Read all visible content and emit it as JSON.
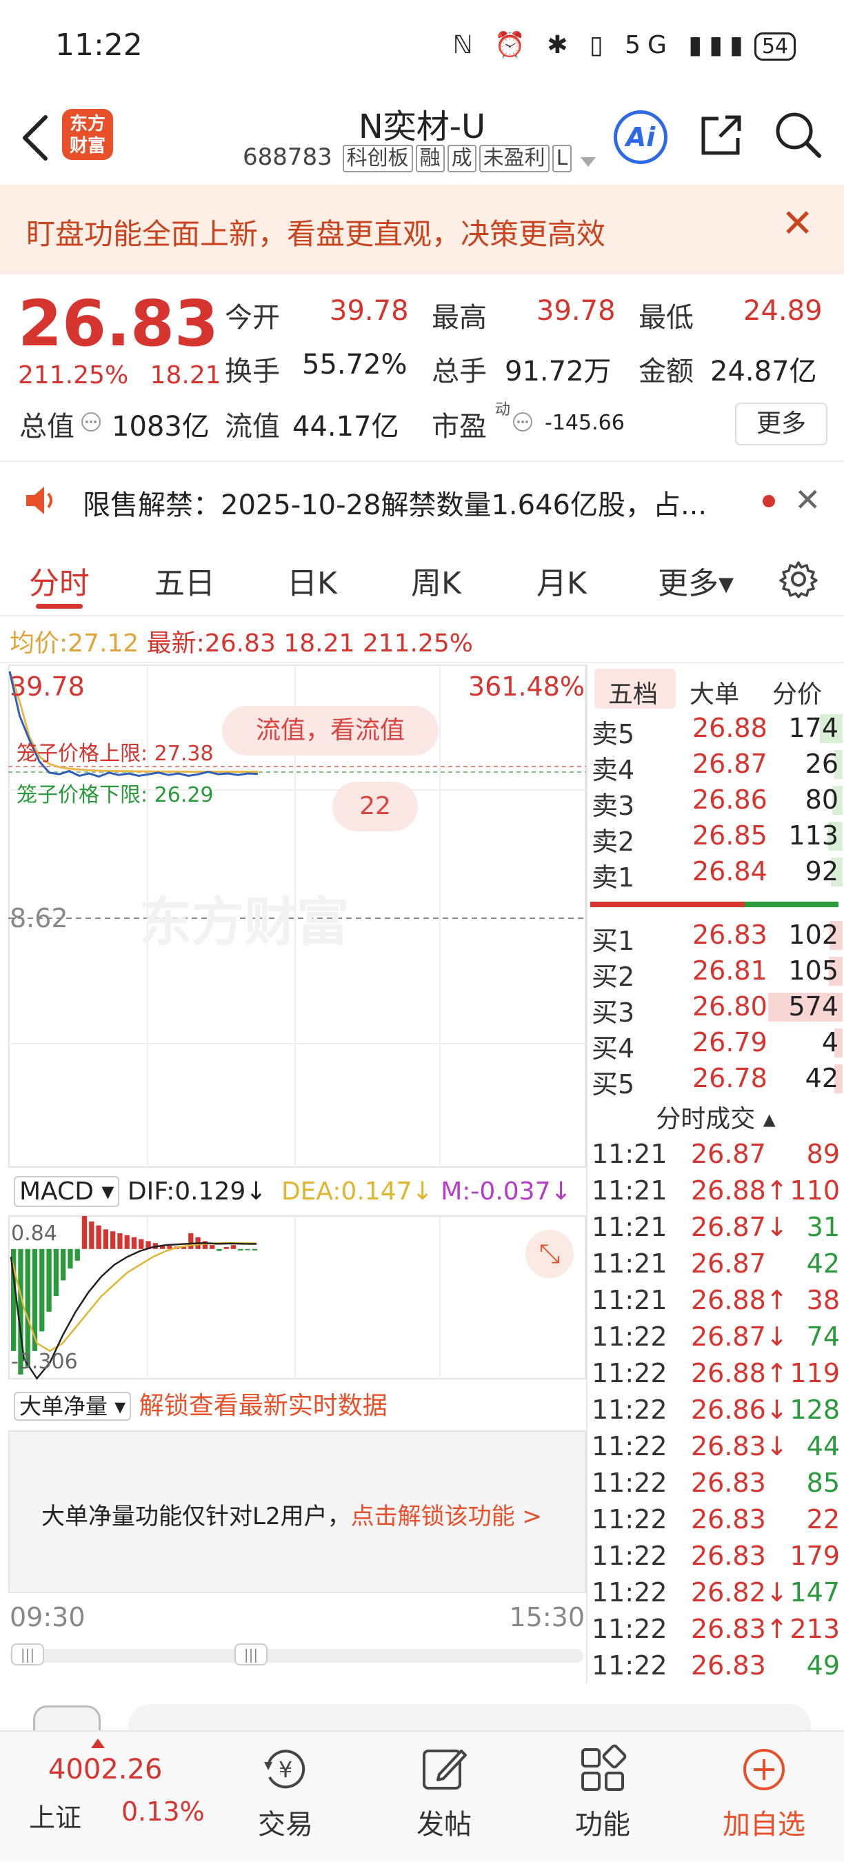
{
  "status_bar": {
    "time": "11:22",
    "icons": "ℕ ⏰ ✱ ▯ 5G ▮▮▮",
    "battery": "54"
  },
  "header": {
    "logo_line1": "东方",
    "logo_line2": "财富",
    "title": "N奕材-U",
    "code": "688783",
    "tags": [
      "科创板",
      "融",
      "成",
      "未盈利",
      "L"
    ],
    "ai_label": "Ai"
  },
  "banner": {
    "text": "盯盘功能全面上新，看盘更直观，决策更高效"
  },
  "quote": {
    "price": "26.83",
    "change_pct": "211.25%",
    "change_amt": "18.21",
    "fields": [
      {
        "label": "今开",
        "value": "39.78",
        "color": "#d6352f"
      },
      {
        "label": "最高",
        "value": "39.78",
        "color": "#d6352f"
      },
      {
        "label": "最低",
        "value": "24.89",
        "color": "#d6352f"
      },
      {
        "label": "换手",
        "value": "55.72%",
        "color": "#222222"
      },
      {
        "label": "总手",
        "value": "91.72万",
        "color": "#222222"
      },
      {
        "label": "金额",
        "value": "24.87亿",
        "color": "#222222"
      },
      {
        "label": "总值",
        "value": "1083亿",
        "color": "#222222"
      },
      {
        "label": "流值",
        "value": "44.17亿",
        "color": "#222222"
      },
      {
        "label": "市盈",
        "value": "-145.66",
        "color": "#222222"
      }
    ],
    "pe_superscript": "动",
    "more_button": "更多"
  },
  "notice": {
    "text": "限售解禁：2025-10-28解禁数量1.646亿股，占..."
  },
  "tabs": [
    "分时",
    "五日",
    "日K",
    "周K",
    "月K",
    "更多▾"
  ],
  "info_line": {
    "avg_label": "均价:",
    "avg_value": "27.12",
    "latest_label": "最新:",
    "latest_value": "26.83",
    "change_amt": "18.21",
    "change_pct": "211.25%"
  },
  "chart": {
    "top_price": "39.78",
    "top_pct": "361.48%",
    "ref_price": "8.62",
    "upper_limit_label": "笼子价格上限: 27.38",
    "lower_limit_label": "笼子价格下限: 26.29",
    "bubble1": "流值，看流值",
    "bubble2": "22",
    "watermark": "东方财富",
    "price_line": [
      39.78,
      34.2,
      31.1,
      28.4,
      27.0,
      26.8,
      27.2,
      26.6,
      26.9,
      26.5,
      27.0,
      26.7,
      26.9,
      26.6,
      26.8,
      27.0,
      26.7,
      26.9,
      26.6,
      26.8,
      27.1,
      26.8,
      26.9,
      26.7,
      26.9,
      26.83
    ],
    "avg_line": [
      39.78,
      36.0,
      31.5,
      29.0,
      28.1,
      27.7,
      27.5,
      27.4,
      27.3,
      27.25,
      27.2,
      27.2,
      27.18,
      27.16,
      27.15,
      27.14,
      27.14,
      27.13,
      27.13,
      27.12,
      27.12,
      27.12,
      27.12,
      27.12,
      27.12,
      27.12
    ],
    "y_range": [
      8.62,
      39.78
    ],
    "time_start": "09:30",
    "time_end": "15:30"
  },
  "macd": {
    "selector": "MACD ▾",
    "dif": "DIF:0.129↓",
    "dea": "DEA:0.147↓",
    "m": "M:-0.037↓",
    "top_value": "0.84",
    "bottom_value": "-3.306",
    "bars": [
      -2.6,
      -3.2,
      -3.0,
      -2.6,
      -2.1,
      -1.6,
      -1.2,
      -0.8,
      -0.5,
      -0.3,
      0.84,
      0.7,
      0.6,
      0.5,
      0.45,
      0.4,
      0.35,
      0.3,
      0.25,
      0.2,
      0.15,
      0.1,
      0.08,
      0.06,
      0.05,
      0.4,
      0.3,
      0.2,
      0.1,
      -0.05,
      0.05,
      0.1,
      -0.04,
      -0.03,
      -0.037
    ],
    "dif_line": [
      -0.2,
      -2.8,
      -3.3,
      -2.9,
      -2.2,
      -1.6,
      -1.1,
      -0.7,
      -0.4,
      -0.2,
      -0.05,
      0.05,
      0.1,
      0.12,
      0.14,
      0.15,
      0.13,
      0.14,
      0.13,
      0.129
    ],
    "dea_line": [
      -0.2,
      -1.5,
      -2.4,
      -2.6,
      -2.4,
      -2.0,
      -1.6,
      -1.2,
      -0.9,
      -0.6,
      -0.4,
      -0.2,
      -0.05,
      0.05,
      0.1,
      0.13,
      0.15,
      0.15,
      0.148,
      0.147
    ]
  },
  "big_order": {
    "selector": "大单净量 ▾",
    "unlock_link": "解锁查看最新实时数据",
    "notice_text": "大单净量功能仅针对L2用户，",
    "notice_link": "点击解锁该功能 >"
  },
  "order_book": {
    "tabs": [
      "五档",
      "大单",
      "分价"
    ],
    "asks": [
      {
        "label": "卖5",
        "price": "26.88",
        "volume": "174"
      },
      {
        "label": "卖4",
        "price": "26.87",
        "volume": "26"
      },
      {
        "label": "卖3",
        "price": "26.86",
        "volume": "80"
      },
      {
        "label": "卖2",
        "price": "26.85",
        "volume": "113"
      },
      {
        "label": "卖1",
        "price": "26.84",
        "volume": "92"
      }
    ],
    "bids": [
      {
        "label": "买1",
        "price": "26.83",
        "volume": "102"
      },
      {
        "label": "买2",
        "price": "26.81",
        "volume": "105"
      },
      {
        "label": "买3",
        "price": "26.80",
        "volume": "574"
      },
      {
        "label": "买4",
        "price": "26.79",
        "volume": "4"
      },
      {
        "label": "买5",
        "price": "26.78",
        "volume": "42"
      }
    ],
    "ticks_title": "分时成交 ▴",
    "ticks": [
      {
        "time": "11:21",
        "price": "26.87",
        "dir": "",
        "volume": "89",
        "color": "#d6352f"
      },
      {
        "time": "11:21",
        "price": "26.88↑",
        "dir": "up",
        "volume": "110",
        "color": "#d6352f"
      },
      {
        "time": "11:21",
        "price": "26.87↓",
        "dir": "down",
        "volume": "31",
        "color": "#2a9a3c"
      },
      {
        "time": "11:21",
        "price": "26.87",
        "dir": "",
        "volume": "42",
        "color": "#2a9a3c"
      },
      {
        "time": "11:21",
        "price": "26.88↑",
        "dir": "up",
        "volume": "38",
        "color": "#d6352f"
      },
      {
        "time": "11:22",
        "price": "26.87↓",
        "dir": "down",
        "volume": "74",
        "color": "#2a9a3c"
      },
      {
        "time": "11:22",
        "price": "26.88↑",
        "dir": "up",
        "volume": "119",
        "color": "#d6352f"
      },
      {
        "time": "11:22",
        "price": "26.86↓",
        "dir": "down",
        "volume": "128",
        "color": "#2a9a3c"
      },
      {
        "time": "11:22",
        "price": "26.83↓",
        "dir": "down",
        "volume": "44",
        "color": "#2a9a3c"
      },
      {
        "time": "11:22",
        "price": "26.83",
        "dir": "",
        "volume": "85",
        "color": "#2a9a3c"
      },
      {
        "time": "11:22",
        "price": "26.83",
        "dir": "",
        "volume": "22",
        "color": "#d6352f"
      },
      {
        "time": "11:22",
        "price": "26.83",
        "dir": "",
        "volume": "179",
        "color": "#d6352f"
      },
      {
        "time": "11:22",
        "price": "26.82↓",
        "dir": "down",
        "volume": "147",
        "color": "#2a9a3c"
      },
      {
        "time": "11:22",
        "price": "26.83↑",
        "dir": "up",
        "volume": "213",
        "color": "#d6352f"
      },
      {
        "time": "11:22",
        "price": "26.83",
        "dir": "",
        "volume": "49",
        "color": "#2a9a3c"
      }
    ]
  },
  "bottom_nav": {
    "index_value": "4002.26",
    "index_name": "上证",
    "index_pct": "0.13%",
    "items": [
      {
        "label": "交易",
        "icon": "¥"
      },
      {
        "label": "发帖",
        "icon": "✎"
      },
      {
        "label": "功能",
        "icon": "▦"
      },
      {
        "label": "加自选",
        "icon": "⊕"
      }
    ]
  },
  "colors": {
    "up": "#d6352f",
    "down": "#2a9a3c",
    "accent": "#e8502a",
    "avg_line": "#e8b84a",
    "price_line": "#2f5fb8"
  }
}
